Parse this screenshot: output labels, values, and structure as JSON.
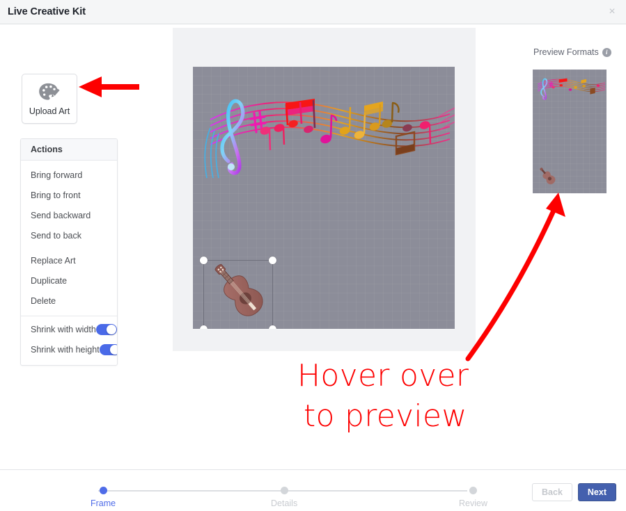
{
  "window": {
    "title": "Live Creative Kit",
    "close_label": "×",
    "close_icon": "close-icon"
  },
  "left_panel": {
    "upload": {
      "label": "Upload Art",
      "icon": "palette-brush-icon"
    },
    "actions": {
      "header": "Actions",
      "items": [
        {
          "label": "Bring forward"
        },
        {
          "label": "Bring to front"
        },
        {
          "label": "Send backward"
        },
        {
          "label": "Send to back"
        },
        {
          "label": "Replace Art"
        },
        {
          "label": "Duplicate"
        },
        {
          "label": "Delete"
        }
      ],
      "toggles": [
        {
          "label": "Shrink with width",
          "on": true
        },
        {
          "label": "Shrink with height",
          "on": true
        }
      ]
    }
  },
  "canvas": {
    "background_color": "#8c8d99",
    "artwork_name": "music-notes-staff-art",
    "selected_element_name": "ukulele-guitar-art",
    "selection_handles": 4
  },
  "right_panel": {
    "preview_title": "Preview Formats",
    "info_icon": "info-icon",
    "thumbnail_name": "story-format-preview"
  },
  "annotations": {
    "hover_line1": "Hover over",
    "hover_line2": "to preview",
    "arrow_color": "#fd0000",
    "arrow_to_upload": "arrow-pointing-to-upload-art",
    "arrow_to_preview": "curved-arrow-pointing-to-preview"
  },
  "footer": {
    "steps": [
      {
        "label": "Frame",
        "active": true
      },
      {
        "label": "Details",
        "active": false
      },
      {
        "label": "Review",
        "active": false
      }
    ],
    "back_label": "Back",
    "next_label": "Next",
    "accent_color": "#4f6ce8",
    "next_button_color": "#4460ae"
  }
}
